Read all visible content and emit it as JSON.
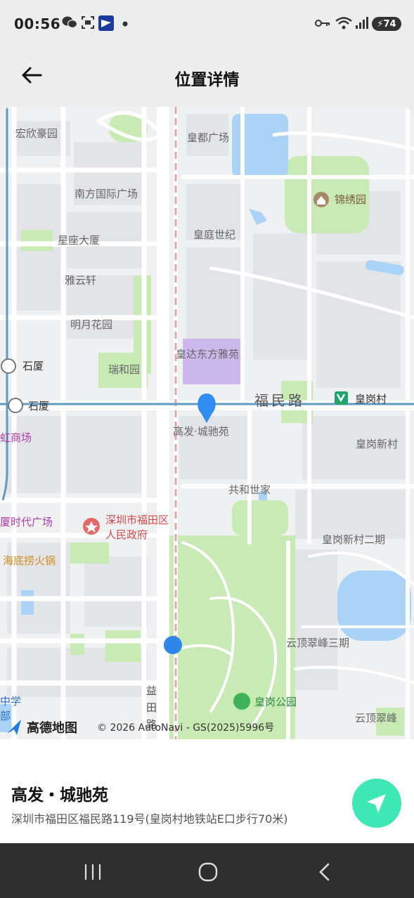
{
  "status_bar": {
    "time": "00:56",
    "battery": "74"
  },
  "header": {
    "title": "位置详情"
  },
  "map": {
    "labels": [
      "宏欣豪园",
      "皇都广场",
      "锦绣园",
      "南方国际广场",
      "星座大厦",
      "皇庭世纪",
      "雅云轩",
      "明月花园",
      "皇达东方雅苑",
      "瑞和园",
      "石厦",
      "石厦",
      "福民路",
      "皇岗村",
      "高发·城驰苑",
      "虹商场",
      "皇岗新村",
      "共和世家",
      "厦时代广场",
      "深圳市福田区",
      "人民政府",
      "皇岗新村二期",
      "海底捞火锅",
      "云顶翠峰三期",
      "益",
      "田",
      "路",
      "中学",
      "皇岗公园",
      "云顶翠峰",
      "部"
    ],
    "brand": "高德地图",
    "copyright": "© 2026 AutoNavi - GS(2025)5996号"
  },
  "place": {
    "name": "高发・城驰苑",
    "address": "深圳市福田区福民路119号(皇岗村地铁站E口步行70米)"
  },
  "colors": {
    "accent": "#3ee8b5",
    "pin": "#2f8ef0",
    "park": "#c8eab4"
  }
}
